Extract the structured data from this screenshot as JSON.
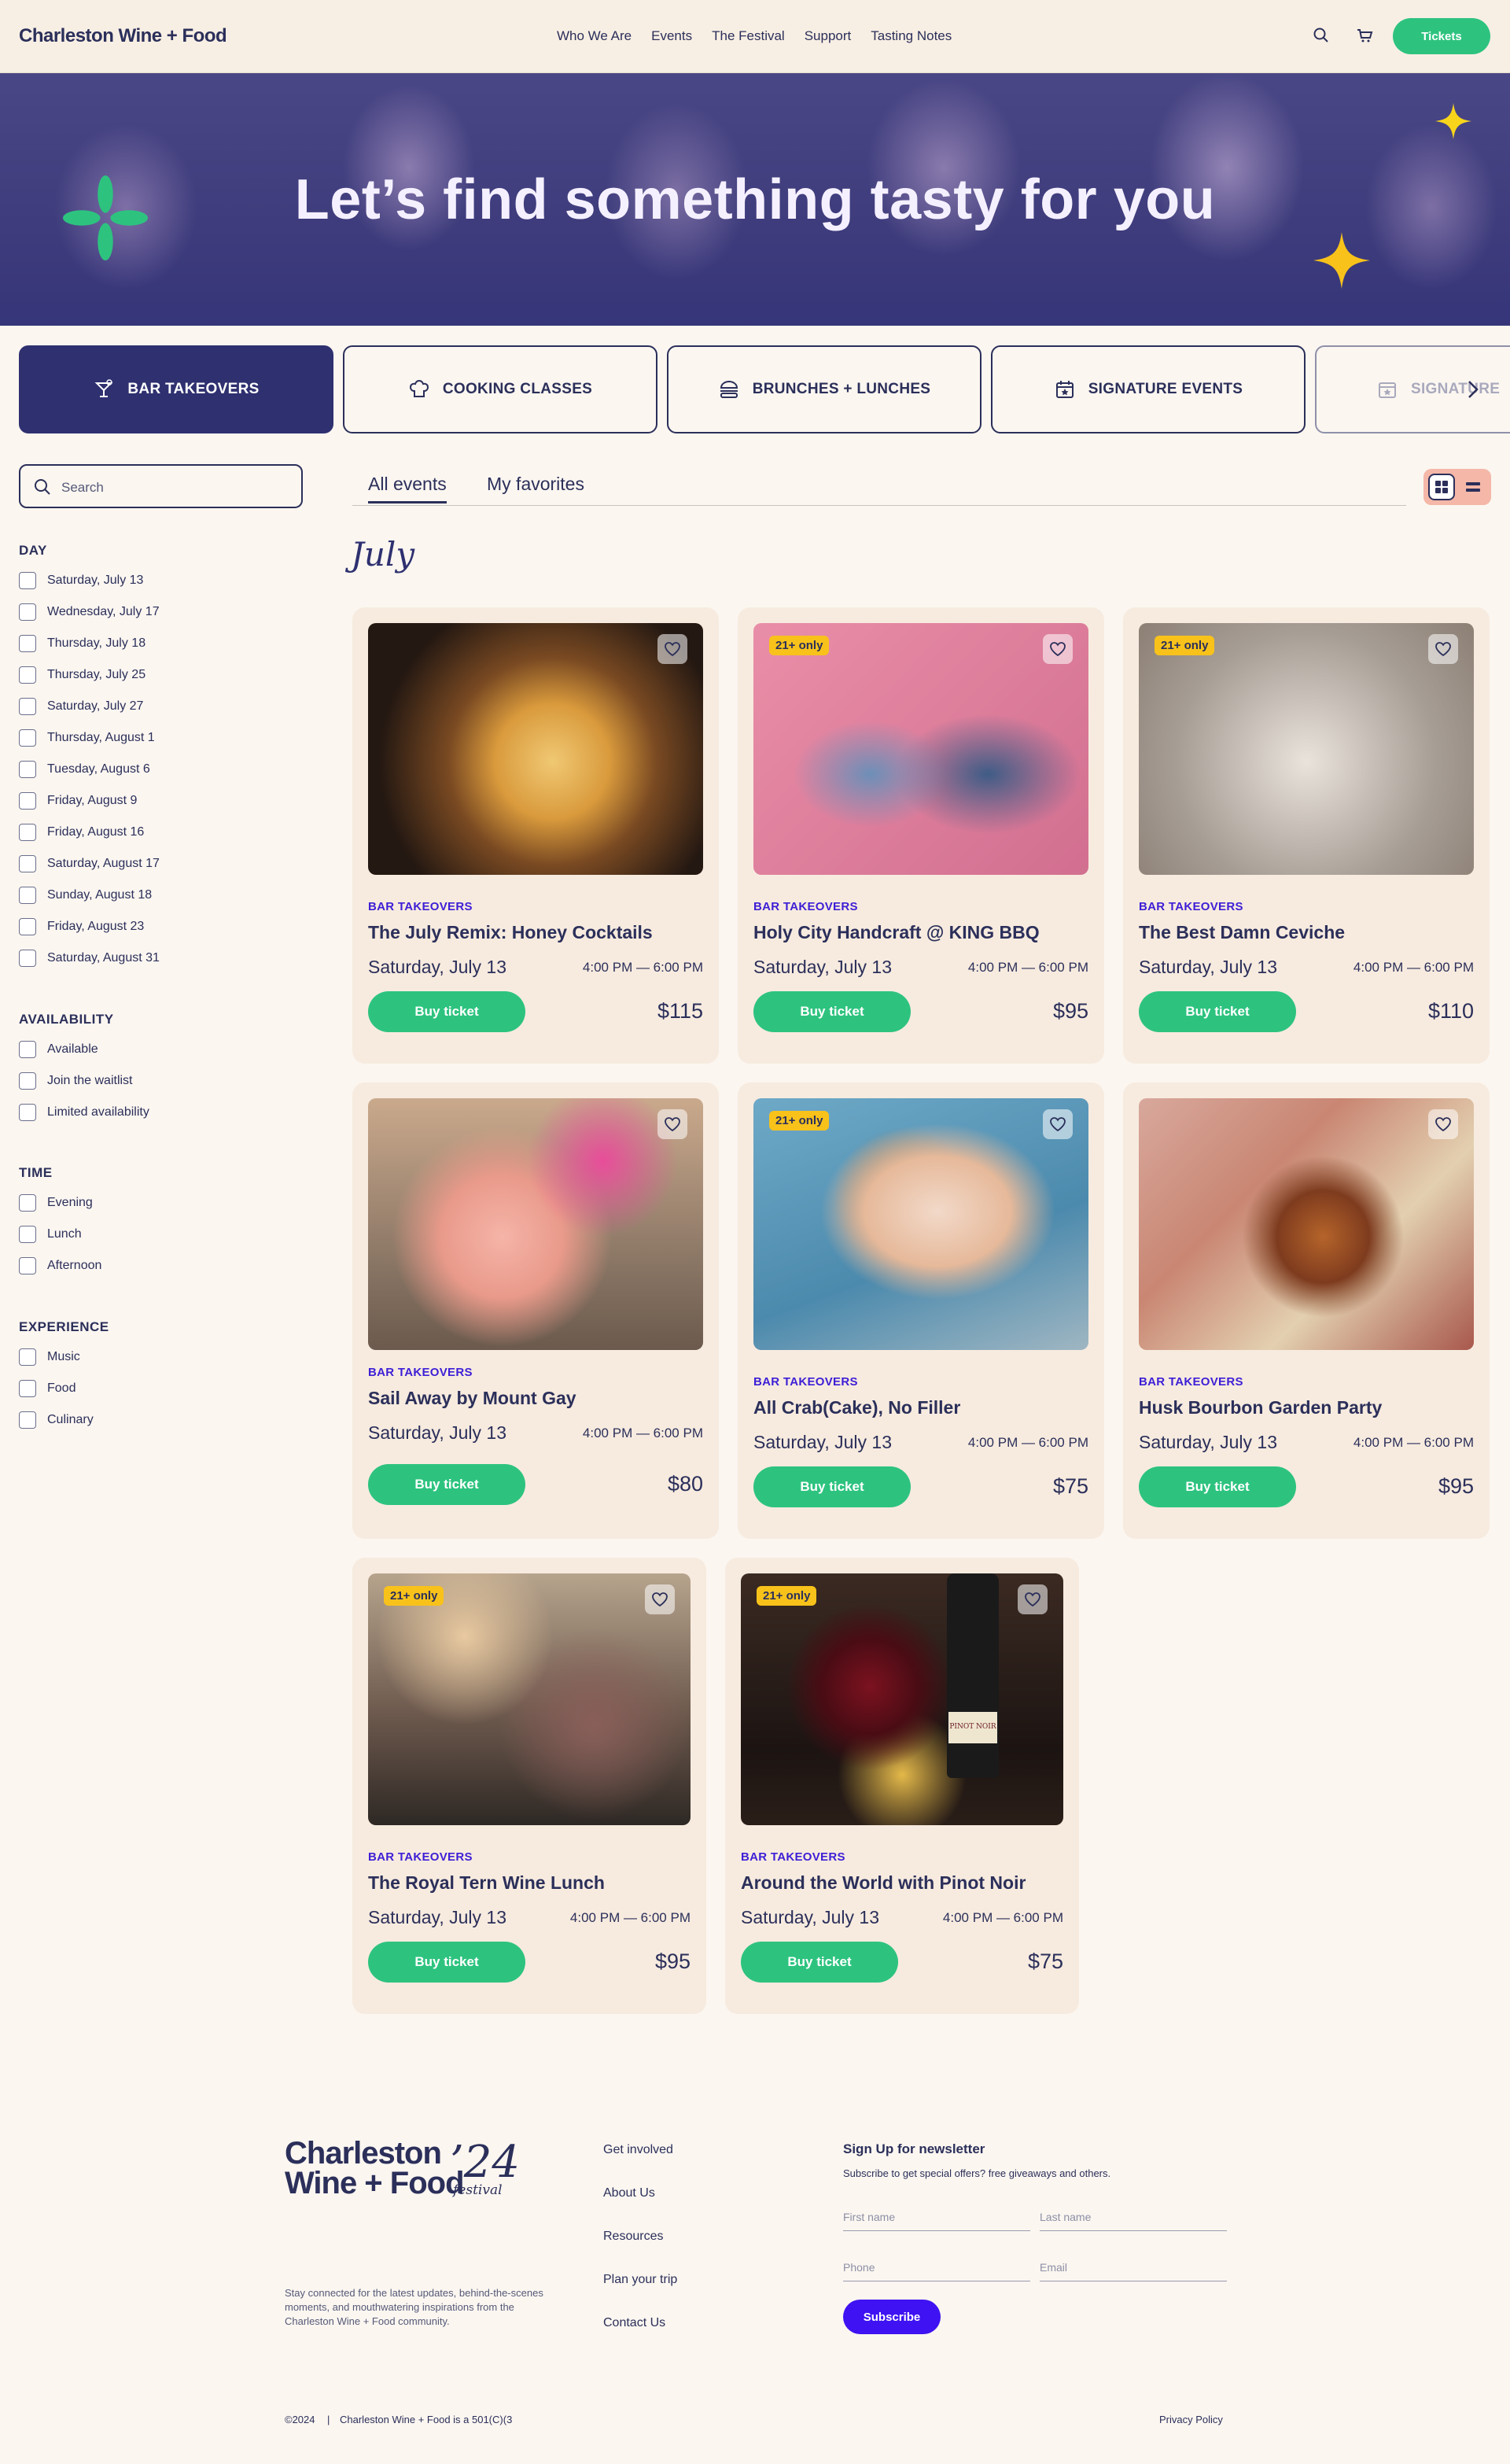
{
  "header": {
    "logo": "Charleston Wine + Food",
    "nav": [
      "Who We Are",
      "Events",
      "The Festival",
      "Support",
      "Tasting Notes"
    ],
    "tickets_label": "Tickets"
  },
  "hero": {
    "title": "Let’s find something tasty for you",
    "colors": {
      "overlay": "#3e3c7c",
      "accent_green": "#2dc37f",
      "accent_yellow": "#f8c21b"
    }
  },
  "categories": [
    {
      "label": "BAR TAKEOVERS",
      "icon": "cocktail-glass-icon",
      "active": true
    },
    {
      "label": "COOKING CLASSES",
      "icon": "chef-hat-icon",
      "active": false
    },
    {
      "label": "BRUNCHES + LUNCHES",
      "icon": "burger-icon",
      "active": false
    },
    {
      "label": "SIGNATURE EVENTS",
      "icon": "calendar-star-icon",
      "active": false
    },
    {
      "label": "SIGNATURE",
      "icon": "calendar-star-icon",
      "active": false
    }
  ],
  "sidebar": {
    "search_placeholder": "Search",
    "groups": [
      {
        "title": "DAY",
        "options": [
          "Saturday, July 13",
          "Wednesday, July 17",
          "Thursday, July 18",
          "Thursday, July 25",
          "Saturday, July 27",
          "Thursday, August 1",
          "Tuesday, August 6",
          "Friday, August 9",
          "Friday, August 16",
          "Saturday, August 17",
          "Sunday, August 18",
          "Friday, August 23",
          "Saturday, August 31"
        ]
      },
      {
        "title": "AVAILABILITY",
        "options": [
          "Available",
          "Join the waitlist",
          "Limited availability"
        ]
      },
      {
        "title": "TIME",
        "options": [
          "Evening",
          "Lunch",
          "Afternoon"
        ]
      },
      {
        "title": "EXPERIENCE",
        "options": [
          "Music",
          "Food",
          "Culinary"
        ]
      }
    ]
  },
  "event_tabs": {
    "all": "All events",
    "favorites": "My favorites"
  },
  "month": "July",
  "events": [
    {
      "category": "BAR TAKEOVERS",
      "title": "The July Remix: Honey Cocktails",
      "date": "Saturday, July 13",
      "time": "4:00 PM — 6:00 PM",
      "price": "$115",
      "button": "Buy ticket",
      "badge": ""
    },
    {
      "category": "BAR TAKEOVERS",
      "title": "Holy City Handcraft @ KING BBQ",
      "date": "Saturday, July 13",
      "time": "4:00 PM — 6:00 PM",
      "price": "$95",
      "button": "Buy ticket",
      "badge": "21+ only"
    },
    {
      "category": "BAR TAKEOVERS",
      "title": "The Best Damn Ceviche",
      "date": "Saturday, July 13",
      "time": "4:00 PM — 6:00 PM",
      "price": "$110",
      "button": "Buy ticket",
      "badge": "21+ only"
    },
    {
      "category": "BAR TAKEOVERS",
      "title": "Sail Away by Mount Gay",
      "date": "Saturday, July 13",
      "time": "4:00 PM — 6:00 PM",
      "price": "$80",
      "button": "Buy ticket",
      "badge": ""
    },
    {
      "category": "BAR TAKEOVERS",
      "title": "All Crab(Cake), No Filler",
      "date": "Saturday, July 13",
      "time": "4:00 PM — 6:00 PM",
      "price": "$75",
      "button": "Buy ticket",
      "badge": "21+ only"
    },
    {
      "category": "BAR TAKEOVERS",
      "title": "Husk Bourbon Garden Party",
      "date": "Saturday, July 13",
      "time": "4:00 PM — 6:00 PM",
      "price": "$95",
      "button": "Buy ticket",
      "badge": ""
    },
    {
      "category": "BAR TAKEOVERS",
      "title": "The Royal Tern Wine Lunch",
      "date": "Saturday, July 13",
      "time": "4:00 PM — 6:00 PM",
      "price": "$95",
      "button": "Buy ticket",
      "badge": "21+ only"
    },
    {
      "category": "BAR TAKEOVERS",
      "title": "Around the World with Pinot Noir",
      "date": "Saturday, July 13",
      "time": "4:00 PM — 6:00 PM",
      "price": "$75",
      "button": "Buy ticket",
      "badge": "21+ only",
      "bottle_label": "PINOT NOIR"
    }
  ],
  "footer": {
    "logo_line1": "Charleston",
    "logo_line2": "Wine + Food",
    "logo_year": "’24",
    "logo_festival": "festival",
    "blurb": "Stay connected for the latest updates, behind-the-scenes moments, and mouthwatering inspirations from the Charleston Wine + Food community.",
    "links": [
      "Get involved",
      "About Us",
      "Resources",
      "Plan your trip",
      "Contact Us"
    ],
    "newsletter": {
      "title": "Sign Up for newsletter",
      "subtitle": "Subscribe to get special offers? free giveaways and others.",
      "first_name": "First name",
      "last_name": "Last name",
      "phone": "Phone",
      "email": "Email",
      "button": "Subscribe"
    },
    "copyright": "©2024",
    "separator": "|",
    "nonprofit": "Charleston Wine + Food is a 501(C)(3",
    "privacy": "Privacy Policy"
  }
}
